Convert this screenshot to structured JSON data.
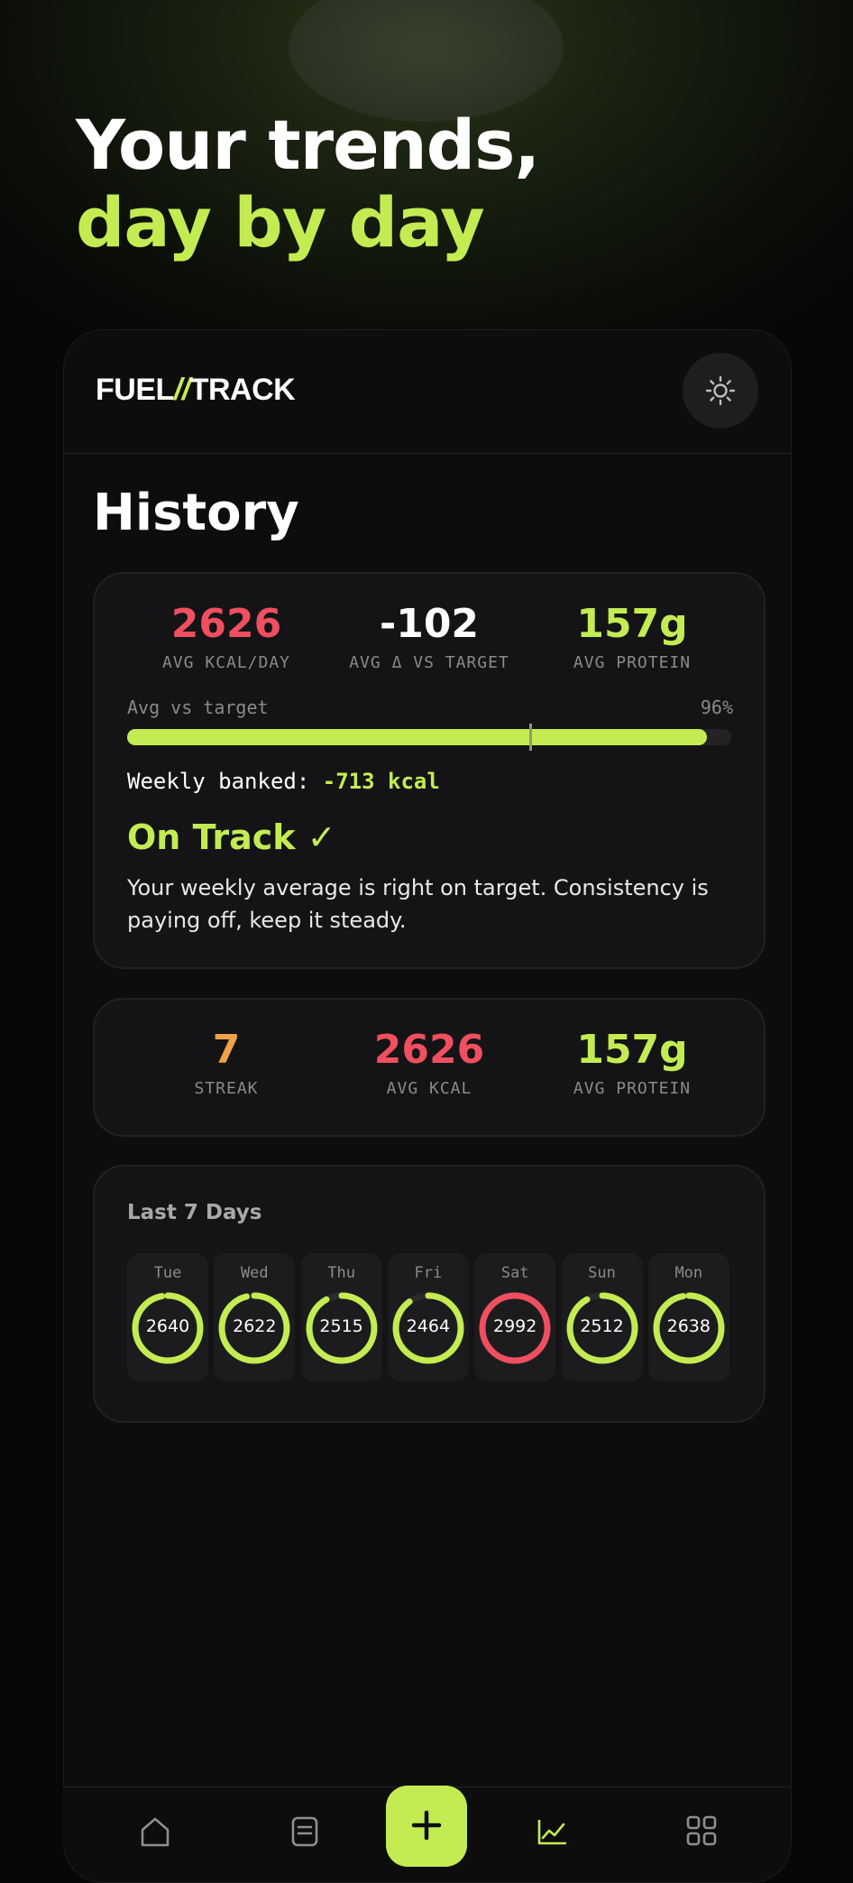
{
  "hero": {
    "line1": "Your trends,",
    "line2": "day by day"
  },
  "app": {
    "brand_part1": "FUEL",
    "brand_slash": "//",
    "brand_part2": "TRACK",
    "theme_icon": "sun-icon"
  },
  "page": {
    "title": "History"
  },
  "summary": {
    "avg_kcal_value": "2626",
    "avg_kcal_label": "AVG KCAL/DAY",
    "avg_delta_value": "-102",
    "avg_delta_label": "AVG Δ VS TARGET",
    "avg_protein_value": "157g",
    "avg_protein_label": "AVG PROTEIN",
    "progress_label": "Avg vs target",
    "progress_pct_text": "96%",
    "progress_fraction": 0.96,
    "target_marker_fraction": 0.665,
    "banked_label": "Weekly banked:",
    "banked_value": "-713 kcal",
    "status_title": "On Track ✓",
    "status_description": "Your weekly average is right on target. Consistency is paying off, keep it steady."
  },
  "stats": {
    "streak_value": "7",
    "streak_label": "STREAK",
    "avg_kcal_value": "2626",
    "avg_kcal_label": "AVG KCAL",
    "avg_protein_value": "157g",
    "avg_protein_label": "AVG PROTEIN"
  },
  "week": {
    "title": "Last 7 Days",
    "days": [
      {
        "name": "Tue",
        "kcal": "2640",
        "fill": 0.97,
        "status": "ok"
      },
      {
        "name": "Wed",
        "kcal": "2622",
        "fill": 0.96,
        "status": "ok"
      },
      {
        "name": "Thu",
        "kcal": "2515",
        "fill": 0.92,
        "status": "ok"
      },
      {
        "name": "Fri",
        "kcal": "2464",
        "fill": 0.9,
        "status": "ok"
      },
      {
        "name": "Sat",
        "kcal": "2992",
        "fill": 1.0,
        "status": "over"
      },
      {
        "name": "Sun",
        "kcal": "2512",
        "fill": 0.92,
        "status": "ok"
      },
      {
        "name": "Mon",
        "kcal": "2638",
        "fill": 0.97,
        "status": "ok"
      }
    ]
  },
  "colors": {
    "accent": "#c3ec52",
    "danger": "#ef4f5f",
    "streak": "#f0a24a",
    "ring_track": "#2a2a2c"
  },
  "nav": {
    "items": [
      "home-icon",
      "log-icon",
      "add-icon",
      "trends-icon",
      "grid-icon"
    ],
    "active": "trends-icon"
  }
}
